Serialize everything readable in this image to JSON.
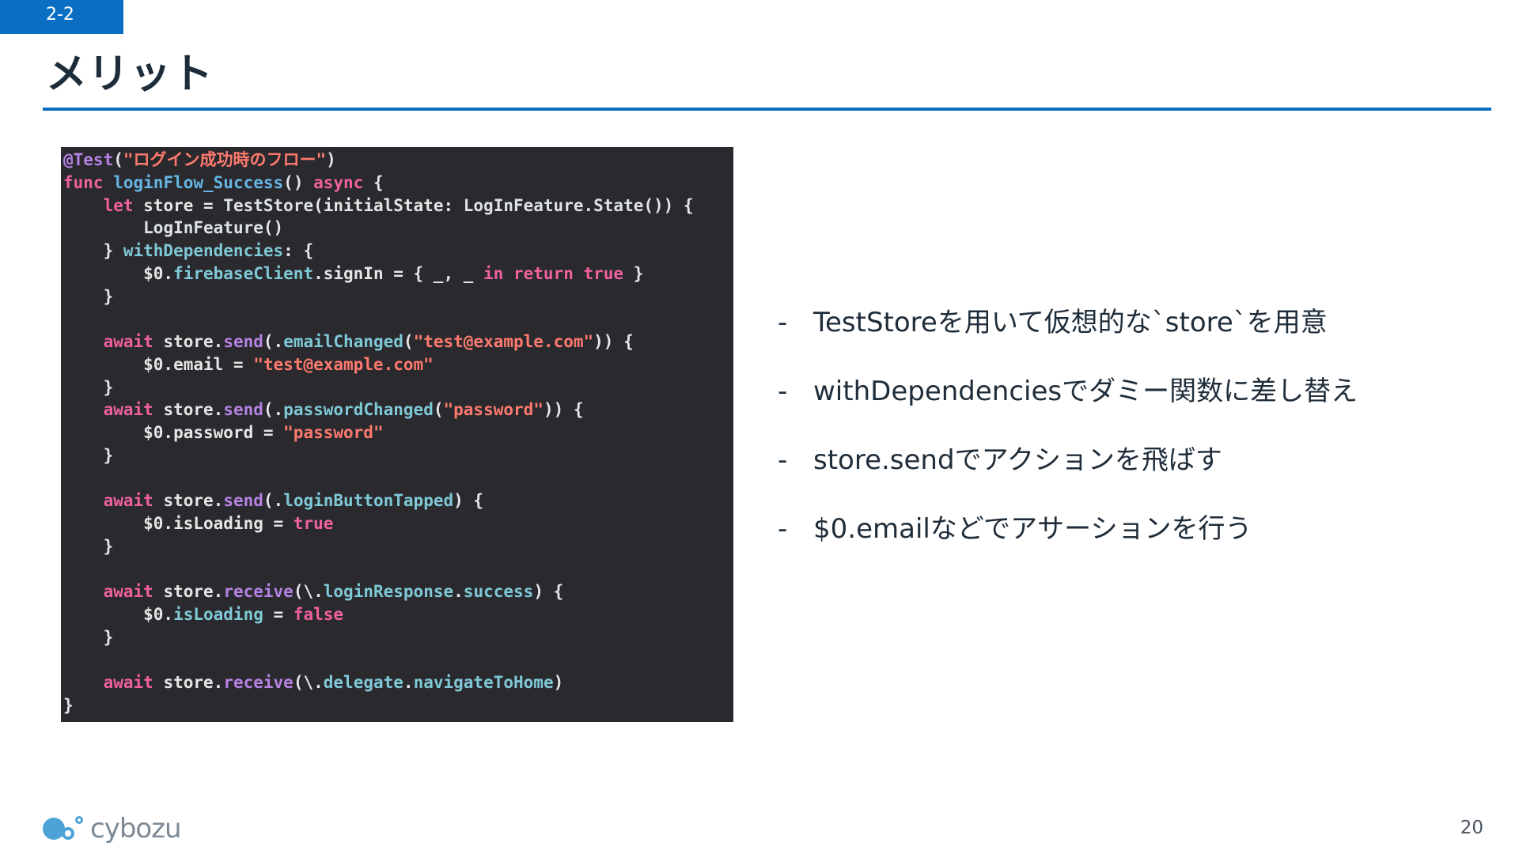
{
  "slide": {
    "section_tag": "2-2",
    "title": "メリット",
    "page_number": "20"
  },
  "code": {
    "language": "swift",
    "lines": [
      [
        {
          "t": "@Test",
          "c": "attr"
        },
        {
          "t": "(",
          "c": "ph"
        },
        {
          "t": "\"ログイン成功時のフロー\"",
          "c": "str"
        },
        {
          "t": ")",
          "c": "ph"
        }
      ],
      [
        {
          "t": "func",
          "c": "kw"
        },
        {
          "t": " ",
          "c": "ph"
        },
        {
          "t": "loginFlow_Success",
          "c": "fn"
        },
        {
          "t": "() ",
          "c": "ph"
        },
        {
          "t": "async",
          "c": "kw"
        },
        {
          "t": " {",
          "c": "ph"
        }
      ],
      [
        {
          "t": "    ",
          "c": "ph"
        },
        {
          "t": "let",
          "c": "kw"
        },
        {
          "t": " store = ",
          "c": "ph"
        },
        {
          "t": "TestStore",
          "c": "type"
        },
        {
          "t": "(initialState: ",
          "c": "ph"
        },
        {
          "t": "LogInFeature",
          "c": "type"
        },
        {
          "t": ".",
          "c": "ph"
        },
        {
          "t": "State",
          "c": "type"
        },
        {
          "t": "()) {",
          "c": "ph"
        }
      ],
      [
        {
          "t": "        ",
          "c": "ph"
        },
        {
          "t": "LogInFeature",
          "c": "type"
        },
        {
          "t": "()",
          "c": "ph"
        }
      ],
      [
        {
          "t": "    } ",
          "c": "ph"
        },
        {
          "t": "withDependencies",
          "c": "prop"
        },
        {
          "t": ": {",
          "c": "ph"
        }
      ],
      [
        {
          "t": "        $0.",
          "c": "ph"
        },
        {
          "t": "firebaseClient",
          "c": "prop"
        },
        {
          "t": ".signIn = { _, _ ",
          "c": "ph"
        },
        {
          "t": "in",
          "c": "kw"
        },
        {
          "t": " ",
          "c": "ph"
        },
        {
          "t": "return",
          "c": "kw"
        },
        {
          "t": " ",
          "c": "ph"
        },
        {
          "t": "true",
          "c": "kw"
        },
        {
          "t": " }",
          "c": "ph"
        }
      ],
      [
        {
          "t": "    }",
          "c": "ph"
        }
      ],
      [],
      [
        {
          "t": "    ",
          "c": "ph"
        },
        {
          "t": "await",
          "c": "kw"
        },
        {
          "t": " store.",
          "c": "ph"
        },
        {
          "t": "send",
          "c": "meth"
        },
        {
          "t": "(.",
          "c": "ph"
        },
        {
          "t": "emailChanged",
          "c": "prop"
        },
        {
          "t": "(",
          "c": "ph"
        },
        {
          "t": "\"test@example.com\"",
          "c": "str"
        },
        {
          "t": ")) {",
          "c": "ph"
        }
      ],
      [
        {
          "t": "        $0.email = ",
          "c": "ph"
        },
        {
          "t": "\"test@example.com\"",
          "c": "str"
        }
      ],
      [
        {
          "t": "    }",
          "c": "ph"
        }
      ],
      [
        {
          "t": "    ",
          "c": "ph"
        },
        {
          "t": "await",
          "c": "kw"
        },
        {
          "t": " store.",
          "c": "ph"
        },
        {
          "t": "send",
          "c": "meth"
        },
        {
          "t": "(.",
          "c": "ph"
        },
        {
          "t": "passwordChanged",
          "c": "prop"
        },
        {
          "t": "(",
          "c": "ph"
        },
        {
          "t": "\"password\"",
          "c": "str"
        },
        {
          "t": ")) {",
          "c": "ph"
        }
      ],
      [
        {
          "t": "        $0.password = ",
          "c": "ph"
        },
        {
          "t": "\"password\"",
          "c": "str"
        }
      ],
      [
        {
          "t": "    }",
          "c": "ph"
        }
      ],
      [],
      [
        {
          "t": "    ",
          "c": "ph"
        },
        {
          "t": "await",
          "c": "kw"
        },
        {
          "t": " store.",
          "c": "ph"
        },
        {
          "t": "send",
          "c": "meth"
        },
        {
          "t": "(.",
          "c": "ph"
        },
        {
          "t": "loginButtonTapped",
          "c": "prop"
        },
        {
          "t": ") {",
          "c": "ph"
        }
      ],
      [
        {
          "t": "        $0.isLoading = ",
          "c": "ph"
        },
        {
          "t": "true",
          "c": "kw"
        }
      ],
      [
        {
          "t": "    }",
          "c": "ph"
        }
      ],
      [],
      [
        {
          "t": "    ",
          "c": "ph"
        },
        {
          "t": "await",
          "c": "kw"
        },
        {
          "t": " store.",
          "c": "ph"
        },
        {
          "t": "receive",
          "c": "meth"
        },
        {
          "t": "(\\.",
          "c": "ph"
        },
        {
          "t": "loginResponse",
          "c": "prop"
        },
        {
          "t": ".",
          "c": "ph"
        },
        {
          "t": "success",
          "c": "prop"
        },
        {
          "t": ") {",
          "c": "ph"
        }
      ],
      [
        {
          "t": "        $0.",
          "c": "ph"
        },
        {
          "t": "isLoading",
          "c": "prop"
        },
        {
          "t": " = ",
          "c": "ph"
        },
        {
          "t": "false",
          "c": "kw"
        }
      ],
      [
        {
          "t": "    }",
          "c": "ph"
        }
      ],
      [],
      [
        {
          "t": "    ",
          "c": "ph"
        },
        {
          "t": "await",
          "c": "kw"
        },
        {
          "t": " store.",
          "c": "ph"
        },
        {
          "t": "receive",
          "c": "meth"
        },
        {
          "t": "(\\.",
          "c": "ph"
        },
        {
          "t": "delegate",
          "c": "prop"
        },
        {
          "t": ".",
          "c": "ph"
        },
        {
          "t": "navigateToHome",
          "c": "prop"
        },
        {
          "t": ")",
          "c": "ph"
        }
      ],
      [
        {
          "t": "}",
          "c": "ph"
        }
      ]
    ]
  },
  "bullets": [
    {
      "dash": "-",
      "text": "TestStoreを用いて仮想的な`store`を用意"
    },
    {
      "dash": "-",
      "text": "withDependenciesでダミー関数に差し替え"
    },
    {
      "dash": "-",
      "text": "store.sendでアクションを飛ばす"
    },
    {
      "dash": "-",
      "text": "$0.emailなどでアサーションを行う"
    }
  ],
  "footer": {
    "logo_text": "cybozu",
    "logo_icon": "cybozu-logo-icon"
  },
  "colors": {
    "accent": "#0a6fc2",
    "code_background": "#29292e",
    "logo": "#4da3d8"
  }
}
